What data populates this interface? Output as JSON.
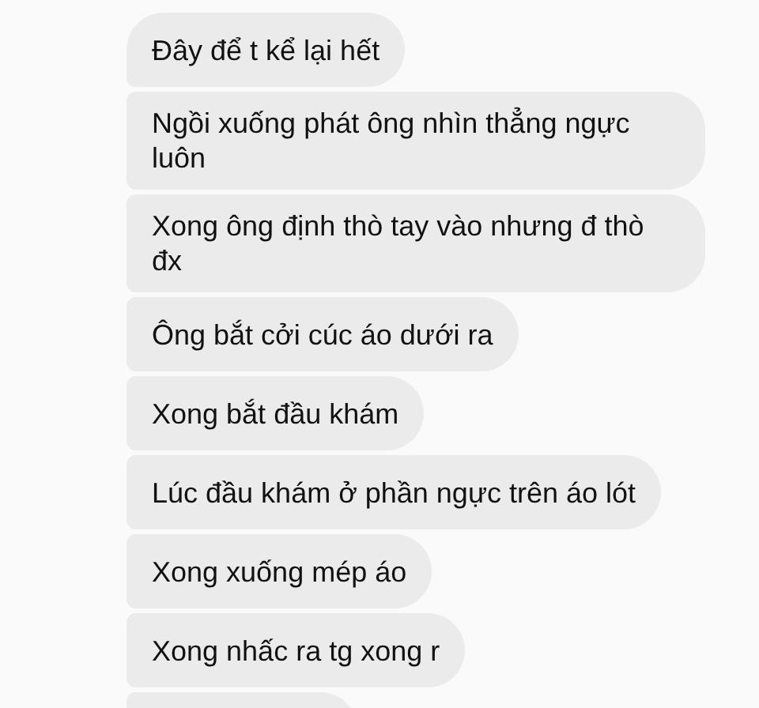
{
  "messages": [
    {
      "text": "Đây để t kể lại hết"
    },
    {
      "text": "Ngồi xuống phát ông nhìn thẳng ngực luôn"
    },
    {
      "text": "Xong ông định thò tay vào nhưng đ thò đx"
    },
    {
      "text": "Ông bắt cởi cúc áo dưới ra"
    },
    {
      "text": "Xong bắt đầu khám"
    },
    {
      "text": "Lúc đầu khám ở phần ngực trên áo lót"
    },
    {
      "text": "Xong xuống mép áo"
    },
    {
      "text": "Xong nhấc ra tg xong r"
    }
  ]
}
